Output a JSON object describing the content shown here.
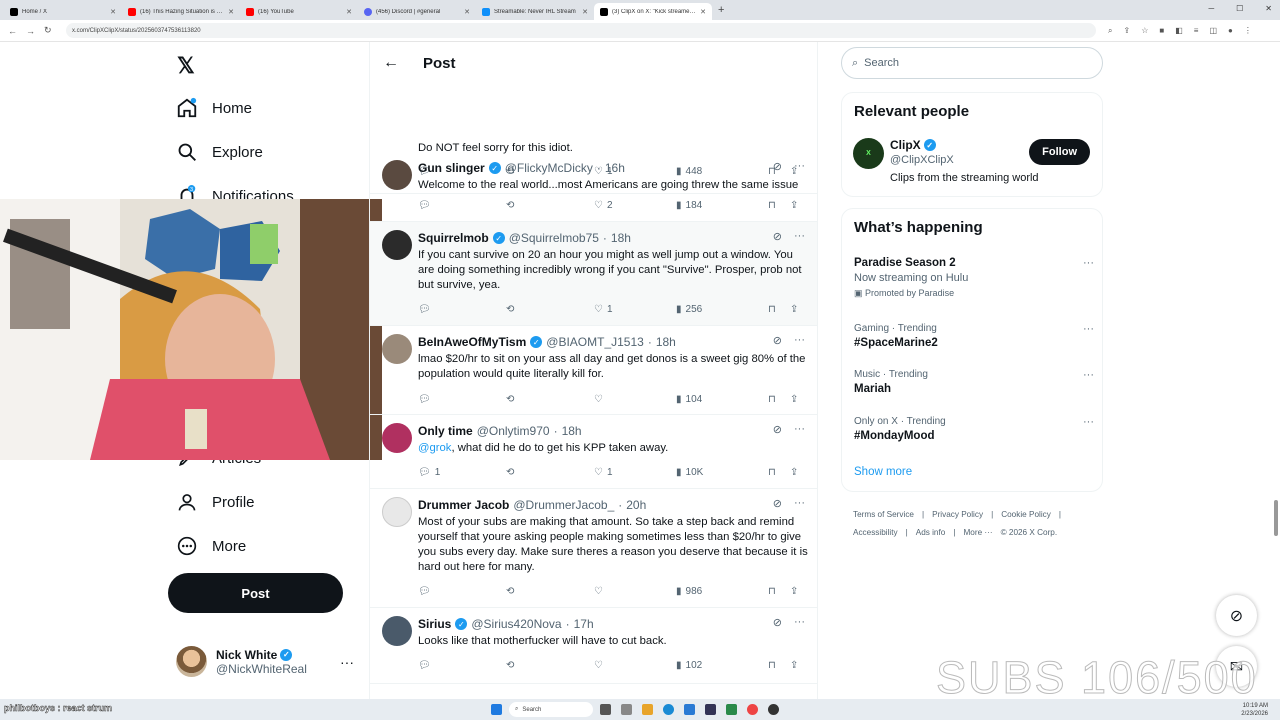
{
  "browser": {
    "tabs": [
      {
        "title": "Home / X",
        "color": "#000000"
      },
      {
        "title": "(16) This Hazing Situation is Cra",
        "color": "#ff0000"
      },
      {
        "title": "(16) YouTube",
        "color": "#ff0000"
      },
      {
        "title": "(456) Discord | #general",
        "color": "#5865f2"
      },
      {
        "title": "Streamable: Never IRL Stream",
        "color": "#0f90fa"
      },
      {
        "title": "(3) ClipX on X: \"Kick streamer N",
        "color": "#000000"
      }
    ],
    "url": "x.com/ClipXClipX/status/2025603747536113820"
  },
  "left_nav": {
    "items": [
      {
        "label": "Home"
      },
      {
        "label": "Explore"
      },
      {
        "label": "Notifications",
        "badge": "3"
      },
      {
        "label": "Articles"
      },
      {
        "label": "Profile"
      },
      {
        "label": "More"
      }
    ],
    "post_label": "Post",
    "account": {
      "name": "Nick White",
      "handle": "@NickWhiteReal"
    }
  },
  "header": {
    "title": "Post"
  },
  "tweets": [
    {
      "name": "",
      "handle": "",
      "time": "",
      "text": "Do NOT feel sorry for this idiot.",
      "replies": "",
      "reposts": "",
      "likes": "1",
      "views": "448"
    },
    {
      "name": "Gun slinger",
      "handle": "@FlickyMcDicky",
      "time": "16h",
      "text": "Welcome to the real world...most Americans are going threw the same issue",
      "replies": "",
      "reposts": "",
      "likes": "2",
      "views": "184"
    },
    {
      "name": "Squirrelmob",
      "handle": "@Squirrelmob75",
      "time": "18h",
      "text": "If you cant survive on 20 an hour you might as well jump out a window. You are doing something incredibly wrong if you cant \"Survive\". Prosper, prob not but survive, yea.",
      "replies": "",
      "reposts": "",
      "likes": "1",
      "views": "256"
    },
    {
      "name": "BeInAweOfMyTism",
      "handle": "@BIAOMT_J1513",
      "time": "18h",
      "text": "lmao $20/hr to sit on your ass all day and get donos is a sweet gig 80% of the population would quite literally kill for.",
      "replies": "",
      "reposts": "",
      "likes": "",
      "views": "104"
    },
    {
      "name": "Only time",
      "handle": "@Onlytim970",
      "time": "18h",
      "mention": "@grok",
      "text": ", what did he do to get his KPP taken away.",
      "replies": "1",
      "reposts": "",
      "likes": "1",
      "views": "10K"
    },
    {
      "name": "Drummer Jacob",
      "handle": "@DrummerJacob_",
      "time": "20h",
      "text": "Most of your subs are making that amount. So take a step back and remind yourself that youre asking people making sometimes less than $20/hr to give you subs every day. Make sure theres a reason you deserve that because it is hard out here for many.",
      "replies": "",
      "reposts": "",
      "likes": "",
      "views": "986"
    },
    {
      "name": "Sirius",
      "handle": "@Sirius420Nova",
      "time": "17h",
      "text": "Looks like that motherfucker will have to cut back.",
      "replies": "",
      "reposts": "",
      "likes": "",
      "views": "102"
    }
  ],
  "right": {
    "search_placeholder": "Search",
    "relevant": {
      "title": "Relevant people",
      "name": "ClipX",
      "handle": "@ClipXClipX",
      "bio": "Clips from the streaming world",
      "follow": "Follow"
    },
    "happening": {
      "title": "What’s happening",
      "trends": [
        {
          "title": "Paradise Season 2",
          "sub": "Now streaming on Hulu",
          "promo": "Promoted by Paradise",
          "cat": ""
        },
        {
          "cat": "Gaming · Trending",
          "title": "#SpaceMarine2",
          "sub": "",
          "promo": ""
        },
        {
          "cat": "Music · Trending",
          "title": "Mariah",
          "sub": "",
          "promo": ""
        },
        {
          "cat": "Only on X · Trending",
          "title": "#MondayMood",
          "sub": "",
          "promo": ""
        }
      ],
      "show_more": "Show more"
    },
    "footer": [
      "Terms of Service",
      "|",
      "Privacy Policy",
      "|",
      "Cookie Policy",
      "|",
      "Accessibility",
      "|",
      "Ads info",
      "|",
      "More ···",
      "© 2026 X Corp."
    ]
  },
  "overlay": {
    "subs": "SUBS 106/500"
  },
  "taskbar": {
    "ticker": "philbotboys : react strum",
    "search": "Search",
    "time": "10:19 AM",
    "date": "2/23/2026"
  }
}
